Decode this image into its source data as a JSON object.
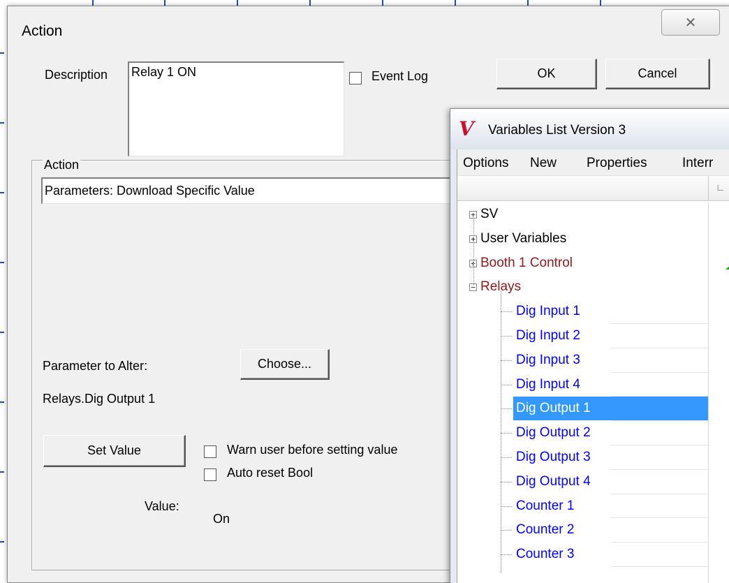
{
  "dialog": {
    "title": "Action",
    "close_glyph": "✕",
    "description_label": "Description",
    "description_value": "Relay 1 ON",
    "event_log_label": "Event Log",
    "event_log_checked": false,
    "ok_label": "OK",
    "cancel_label": "Cancel",
    "action_group_label": "Action",
    "action_value": "Parameters: Download Specific Value",
    "parameter_label": "Parameter to Alter:",
    "choose_label": "Choose...",
    "parameter_value": "Relays.Dig Output 1",
    "set_value_label": "Set Value",
    "warn_label": "Warn user before setting value",
    "warn_checked": false,
    "auto_reset_label": "Auto reset Bool",
    "auto_reset_checked": false,
    "value_label": "Value:",
    "value_text": "On"
  },
  "variables_window": {
    "logo_glyph": "V",
    "title": "Variables List Version 3",
    "menu": [
      "Options",
      "New",
      "Properties",
      "Interr"
    ],
    "column_mark": "∟",
    "tree": {
      "roots": [
        {
          "label": "SV",
          "expander": "+",
          "color": "#000000"
        },
        {
          "label": "User Variables",
          "expander": "+",
          "color": "#000000"
        },
        {
          "label": "Booth 1 Control",
          "expander": "+",
          "color": "#8b1a1a"
        },
        {
          "label": "Relays",
          "expander": "−",
          "color": "#8b1a1a"
        }
      ],
      "children": [
        "Dig Input 1",
        "Dig Input 2",
        "Dig Input 3",
        "Dig Input 4",
        "Dig Output 1",
        "Dig Output 2",
        "Dig Output 3",
        "Dig Output 4",
        "Counter 1",
        "Counter 2",
        "Counter 3"
      ],
      "selected_child": "Dig Output 1",
      "child_color": "#0000ee",
      "selected_bg": "#3399ff"
    }
  }
}
